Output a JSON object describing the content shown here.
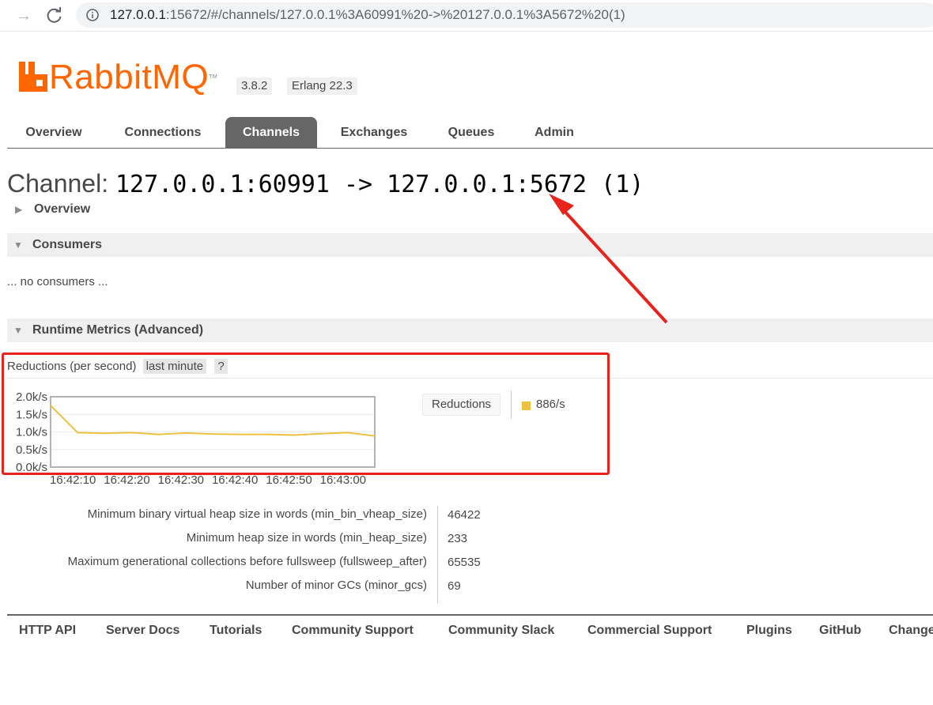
{
  "browser": {
    "url_host": "127.0.0.1",
    "url_rest": ":15672/#/channels/127.0.0.1%3A60991%20->%20127.0.0.1%3A5672%20(1)"
  },
  "header": {
    "brand": "RabbitMQ",
    "trademark": "TM",
    "version": "3.8.2",
    "erlang": "Erlang 22.3"
  },
  "tabs": [
    {
      "label": "Overview",
      "active": false
    },
    {
      "label": "Connections",
      "active": false
    },
    {
      "label": "Channels",
      "active": true
    },
    {
      "label": "Exchanges",
      "active": false
    },
    {
      "label": "Queues",
      "active": false
    },
    {
      "label": "Admin",
      "active": false
    }
  ],
  "page": {
    "title_label": "Channel:",
    "title_name": "127.0.0.1:60991 -> 127.0.0.1:5672 (1)"
  },
  "sections": {
    "overview": "Overview",
    "consumers": "Consumers",
    "no_consumers": "... no consumers ...",
    "runtime": "Runtime Metrics (Advanced)"
  },
  "chart_header": {
    "title": "Reductions (per second)",
    "range": "last minute",
    "help": "?"
  },
  "chart_data": {
    "type": "line",
    "x": [
      "16:42:05",
      "16:42:10",
      "16:42:20",
      "16:42:30",
      "16:42:40",
      "16:42:50",
      "16:43:00",
      "16:43:05"
    ],
    "x_points": [
      "16:42:05",
      "16:42:10",
      "16:42:15",
      "16:42:20",
      "16:42:25",
      "16:42:30",
      "16:42:35",
      "16:42:40",
      "16:42:45",
      "16:42:50",
      "16:42:55",
      "16:43:00",
      "16:43:05"
    ],
    "series": [
      {
        "name": "Reductions",
        "color": "#edc240",
        "values": [
          1750,
          980,
          960,
          980,
          930,
          970,
          940,
          930,
          930,
          910,
          950,
          980,
          886
        ]
      }
    ],
    "ylim": [
      0,
      2000
    ],
    "yticks": [
      "0.0k/s",
      "0.5k/s",
      "1.0k/s",
      "1.5k/s",
      "2.0k/s"
    ],
    "xticks": [
      "16:42:10",
      "16:42:20",
      "16:42:30",
      "16:42:40",
      "16:42:50",
      "16:43:00"
    ],
    "grid": true,
    "legend": "right"
  },
  "legend": {
    "button_label": "Reductions",
    "value": "886/s",
    "swatch_color": "#edc240"
  },
  "properties": [
    {
      "key": "Minimum binary virtual heap size in words (min_bin_vheap_size)",
      "value": "46422"
    },
    {
      "key": "Minimum heap size in words (min_heap_size)",
      "value": "233"
    },
    {
      "key": "Maximum generational collections before fullsweep (fullsweep_after)",
      "value": "65535"
    },
    {
      "key": "Number of minor GCs (minor_gcs)",
      "value": "69"
    }
  ],
  "footer": [
    "HTTP API",
    "Server Docs",
    "Tutorials",
    "Community Support",
    "Community Slack",
    "Commercial Support",
    "Plugins",
    "GitHub",
    "Changelog"
  ],
  "annotation_color": "#e8231b"
}
